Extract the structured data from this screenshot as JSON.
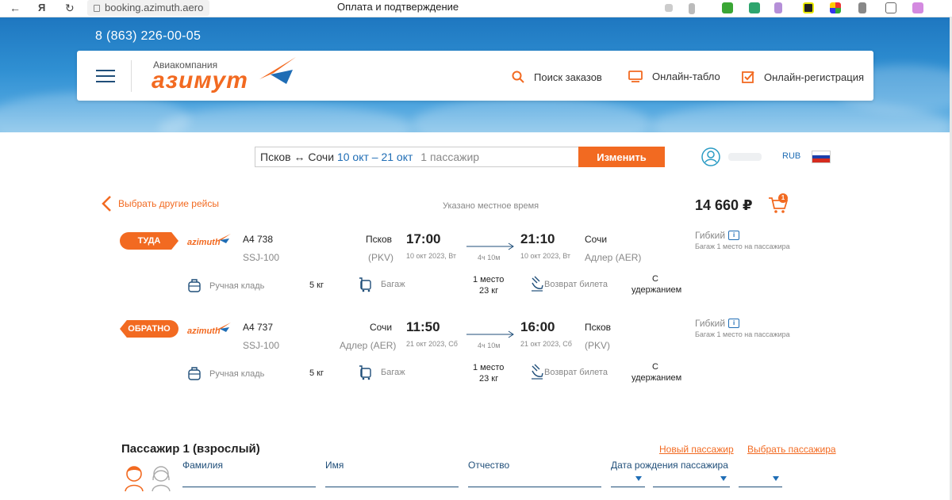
{
  "browser": {
    "url": "booking.azimuth.aero",
    "title": "Оплата и подтверждение"
  },
  "header": {
    "phone": "8 (863) 226-00-05",
    "logo_sub": "Авиакомпания",
    "logo_main": "азимут",
    "nav": [
      "Поиск заказов",
      "Онлайн-табло",
      "Онлайн-регистрация"
    ]
  },
  "search": {
    "route": "Псков ↔ Сочи",
    "dates": "10 окт – 21 окт",
    "pax": "1 пассажир",
    "change_label": "Изменить",
    "currency": "RUB"
  },
  "summary": {
    "back_label": "Выбрать другие рейсы",
    "local_time_note": "Указано местное время",
    "price": "14 660 ₽",
    "cart_count": "1"
  },
  "flights": [
    {
      "direction": "ТУДА",
      "airline": "azimuth",
      "flight_no": "А4 738",
      "aircraft": "SSJ-100",
      "from_city": "Псков",
      "from_code": "(PKV)",
      "dep_time": "17:00",
      "dep_date": "10 окт 2023, Вт",
      "duration": "4ч 10м",
      "arr_time": "21:10",
      "arr_date": "10 окт 2023, Вт",
      "to_city": "Сочи",
      "to_code": "Адлер (AER)",
      "fare": "Гибкий",
      "fare_note": "Багаж 1 место на пассажира",
      "hand_label": "Ручная кладь",
      "hand_value": "5 кг",
      "bag_label": "Багаж",
      "bag_value_1": "1 место",
      "bag_value_2": "23 кг",
      "refund_label": "Возврат билета",
      "refund_value_1": "С",
      "refund_value_2": "удержанием"
    },
    {
      "direction": "ОБРАТНО",
      "airline": "azimuth",
      "flight_no": "А4 737",
      "aircraft": "SSJ-100",
      "from_city": "Сочи",
      "from_code": "Адлер (AER)",
      "dep_time": "11:50",
      "dep_date": "21 окт 2023, Сб",
      "duration": "4ч 10м",
      "arr_time": "16:00",
      "arr_date": "21 окт 2023, Сб",
      "to_city": "Псков",
      "to_code": "(PKV)",
      "fare": "Гибкий",
      "fare_note": "Багаж 1 место на пассажира",
      "hand_label": "Ручная кладь",
      "hand_value": "5 кг",
      "bag_label": "Багаж",
      "bag_value_1": "1 место",
      "bag_value_2": "23 кг",
      "refund_label": "Возврат билета",
      "refund_value_1": "С",
      "refund_value_2": "удержанием"
    }
  ],
  "passenger": {
    "title": "Пассажир 1 (взрослый)",
    "new_link": "Новый пассажир",
    "choose_link": "Выбрать пассажира",
    "fields": [
      "Фамилия",
      "Имя",
      "Отчество",
      "Дата рождения пассажира"
    ]
  },
  "colors": {
    "accent": "#f26a21",
    "brand_blue": "#1f4e79",
    "link_blue": "#1f6db5"
  }
}
